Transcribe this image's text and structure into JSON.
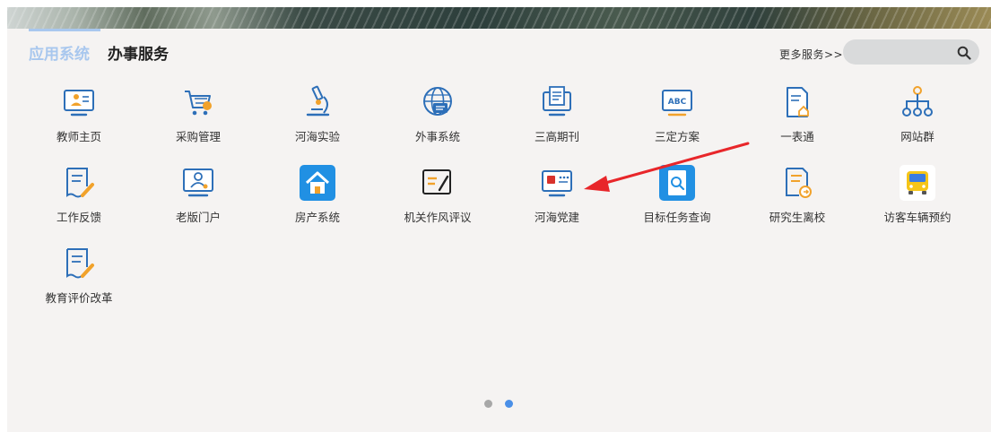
{
  "tabs": {
    "apps": "应用系统",
    "office": "办事服务"
  },
  "header": {
    "more_link": "更多服务>>",
    "search_placeholder": "",
    "search_value": ""
  },
  "apps": [
    {
      "label": "教师主页",
      "icon": "teacher-home-icon"
    },
    {
      "label": "采购管理",
      "icon": "shopping-cart-icon"
    },
    {
      "label": "河海实验",
      "icon": "microscope-icon"
    },
    {
      "label": "外事系统",
      "icon": "globe-icon"
    },
    {
      "label": "三高期刊",
      "icon": "journal-monitor-icon"
    },
    {
      "label": "三定方案",
      "icon": "abc-board-icon"
    },
    {
      "label": "一表通",
      "icon": "document-home-icon"
    },
    {
      "label": "网站群",
      "icon": "network-tree-icon"
    },
    {
      "label": "工作反馈",
      "icon": "feedback-pen-icon"
    },
    {
      "label": "老版门户",
      "icon": "portal-user-icon"
    },
    {
      "label": "房产系统",
      "icon": "house-icon"
    },
    {
      "label": "机关作风评议",
      "icon": "review-pen-icon"
    },
    {
      "label": "河海党建",
      "icon": "party-monitor-icon"
    },
    {
      "label": "目标任务查询",
      "icon": "search-document-icon"
    },
    {
      "label": "研究生离校",
      "icon": "graduate-leave-icon"
    },
    {
      "label": "访客车辆预约",
      "icon": "bus-icon"
    },
    {
      "label": "教育评价改革",
      "icon": "evaluation-pen-icon"
    }
  ],
  "pager": {
    "pages": 2,
    "current": 2
  },
  "colors": {
    "accent_blue": "#4a8fe7",
    "active_tab": "#a8c7ee",
    "panel_bg": "#f5f3f2",
    "arrow_red": "#e8262a",
    "party_red": "#d8322c"
  }
}
